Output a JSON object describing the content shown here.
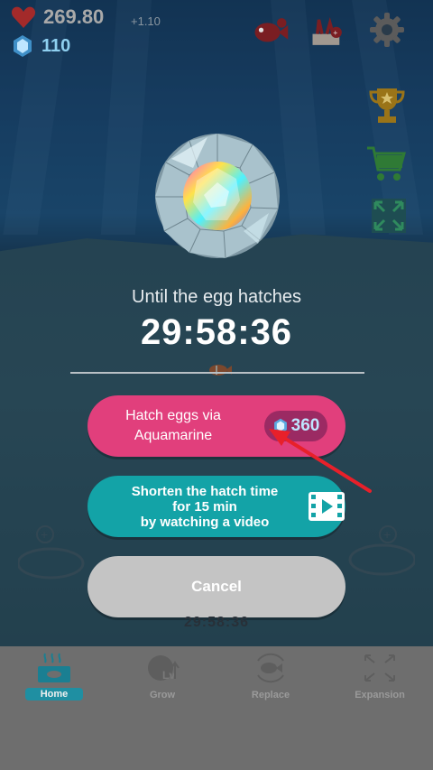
{
  "hud": {
    "hearts_value": "269.80",
    "hearts_rate": "+1.10",
    "gems_value": "110"
  },
  "top_icons": [
    "fish-shop-icon",
    "decoration-icon",
    "settings-gear-icon"
  ],
  "side_icons": [
    "trophy-icon",
    "shopping-cart-icon",
    "expand-view-icon"
  ],
  "dialog": {
    "caption": "Until the egg hatches",
    "timer": "29:58:36",
    "hatch_button": {
      "label_line1": "Hatch eggs via",
      "label_line2": "Aquamarine",
      "cost": "360"
    },
    "video_button": {
      "line1": "Shorten the hatch time",
      "line2": "for 15 min",
      "line3": "by watching a video"
    },
    "cancel_label": "Cancel"
  },
  "background_timer": "29:58:36",
  "nav": [
    {
      "label": "Home",
      "icon": "aquarium-home-icon",
      "active": true
    },
    {
      "label": "Grow",
      "icon": "grow-fish-icon",
      "active": false
    },
    {
      "label": "Replace",
      "icon": "replace-fish-icon",
      "active": false
    },
    {
      "label": "Expansion",
      "icon": "expansion-arrows-icon",
      "active": false
    }
  ],
  "colors": {
    "hatch_button": "#e13f7c",
    "video_button": "#13a3a7",
    "cancel_button": "#c4c4c4",
    "annotation_arrow": "#e8202a"
  }
}
